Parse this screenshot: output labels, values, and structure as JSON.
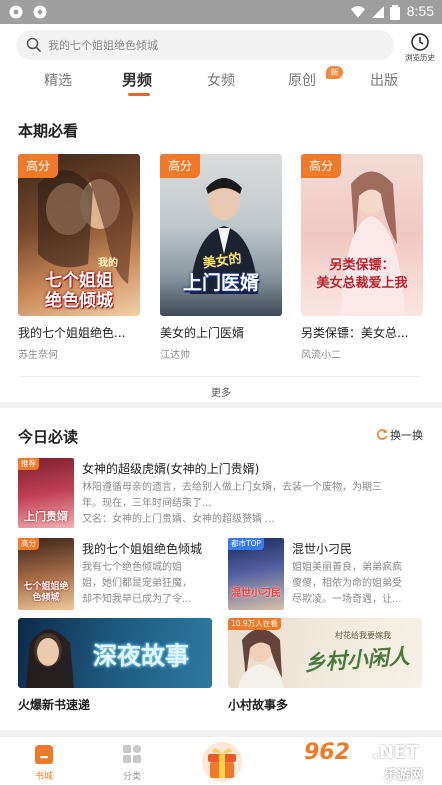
{
  "status_bar": {
    "time": "8:55"
  },
  "search": {
    "placeholder": "我的七个姐姐绝色倾城"
  },
  "history": {
    "label": "浏览历史"
  },
  "tabs": [
    {
      "label": "精选",
      "active": false
    },
    {
      "label": "男频",
      "active": true
    },
    {
      "label": "女频",
      "active": false
    },
    {
      "label": "原创",
      "active": false,
      "badge": "新"
    },
    {
      "label": "出版",
      "active": false
    }
  ],
  "featured": {
    "title": "本期必看",
    "books": [
      {
        "tag": "高分",
        "title": "我的七个姐姐绝色...",
        "author": "苏生奈何",
        "cover_small": "我的",
        "cover_line1": "七个姐姐",
        "cover_line2": "绝色倾城"
      },
      {
        "tag": "高分",
        "title": "美女的上门医婿",
        "author": "江达帅",
        "cover_small": "美女的",
        "cover_line1": "上门医婿"
      },
      {
        "tag": "高分",
        "title": "另类保镖：美女总...",
        "author": "风流小二",
        "cover_line1": "另类保镖：",
        "cover_line2": "美女总裁爱上我"
      }
    ],
    "more_label": "更多"
  },
  "daily": {
    "title": "今日必读",
    "swap_label": "换一换",
    "top_item": {
      "tag": "推荐",
      "cover_text": "上门贵婿",
      "title": "女神的超级虎婿(女神的上门贵婿)",
      "desc_line1": "林阳遵循母亲的遗言，去给别人做上门女婿，去装一个废物，为期三",
      "desc_line2": "年。现在，三年时间结束了...",
      "desc_line3": "又名：女神的上门贵婿、女神的超级赘婿 ..."
    },
    "items": [
      {
        "tag": "高分",
        "cover_text": "七个姐姐绝色倾城",
        "title": "我的七个姐姐绝色倾城",
        "desc_line1": "我有七个绝色倾城的姐",
        "desc_line2": "姐，她们都是宠弟狂魔，",
        "desc_line3": "却不知我早已成为了令..."
      },
      {
        "tag": "都市TOP",
        "cover_text": "混世小刁民",
        "title": "混世小刁民",
        "desc_line1": "姐姐美丽善良，弟弟疯疯",
        "desc_line2": "傻傻，相依为命的姐弟受",
        "desc_line3": "尽欺凌。一场奇遇，让..."
      }
    ],
    "banners": [
      {
        "text": "深夜故事",
        "label": "火爆新书速递"
      },
      {
        "tag": "10.9万人在看",
        "top_text": "村花给我要嫁我",
        "text": "乡村小闲人",
        "label": "小村故事多"
      }
    ]
  },
  "bottom_nav": [
    {
      "label": "书城",
      "active": true
    },
    {
      "label": "分类",
      "active": false
    }
  ],
  "watermark": {
    "num": "962",
    "net": ".NET",
    "cn": "乐游网"
  },
  "colors": {
    "accent": "#f07a2a",
    "tab_active_underline": "#e26a26",
    "status_bar": "#9e9e9e"
  }
}
